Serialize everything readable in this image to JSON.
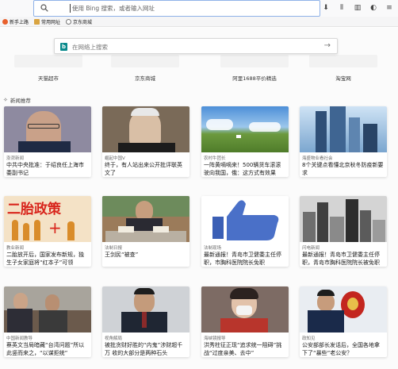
{
  "urlbar": {
    "placeholder": "使用 Bing 搜索，或者输入网址"
  },
  "toolbar_icons": [
    "download-icon",
    "library-icon",
    "sidebar-icon",
    "reader-icon",
    "menu-icon"
  ],
  "bookmarks": [
    {
      "label": "新手上路",
      "icon": "firefox-icon",
      "color": "#e8602c"
    },
    {
      "label": "常用网址",
      "icon": "folder-icon",
      "color": "#d9a441"
    },
    {
      "label": "京东商城",
      "icon": "globe-icon",
      "color": "#777777"
    }
  ],
  "bing": {
    "placeholder": "在网络上搜索",
    "logo": "b"
  },
  "shortcuts": [
    {
      "label": "天猫超市"
    },
    {
      "label": "京东商城"
    },
    {
      "label": "阿里1688平价精选"
    },
    {
      "label": "淘宝网"
    }
  ],
  "section": {
    "title": "新闻推荐"
  },
  "cards": [
    {
      "source": "澎湃新闻",
      "title": "中共中央批准：于绍良任上海市委副书记",
      "img": "portrait-glasses"
    },
    {
      "source": "崛起中国V",
      "title": "终于，有人站出来公开批评联英文了",
      "img": "portrait-elder"
    },
    {
      "source": "农村牛团长",
      "title": "一阵黄嘀嘀来！500辆货车滚滚驶向我国，俄：这方式有效果",
      "img": "grassland"
    },
    {
      "source": "海盛物业看社会",
      "title": "8个关键点看懂北京秋冬防疫新要求",
      "img": "skyscrapers"
    },
    {
      "source": "教业新闻",
      "title": "二胎放开后，国家发布新规，独生子女家庭将“红本子”可领",
      "img": "two-child-poster"
    },
    {
      "source": "法制日报",
      "title": "王剑民“被查”",
      "img": "meeting"
    },
    {
      "source": "法制现场",
      "title": "最新通报！青岛市卫健委主任停职，市胸科医院院长免职",
      "img": "thumbs-up"
    },
    {
      "source": "闪电新闻",
      "title": "最新通报！青岛市卫健委主任停职，青岛市胸科医院院长被免职",
      "img": "city-bw"
    },
    {
      "source": "中国新闻教导",
      "title": "蔡英文当局暗藏“台湾问题”所以此竖而来之，“以谋拒统”",
      "img": "two-men"
    },
    {
      "source": "视角解局",
      "title": "被批贪财好胜的“内鬼”涉财超千万 收的大部分是两种石头",
      "img": "official"
    },
    {
      "source": "海峡镜报导",
      "title": "洪秀柱征正现“追求统一阻碍”挑战“过度亲美、去中”",
      "img": "woman-mask"
    },
    {
      "source": "政知见",
      "title": "公安部部长发话后，全国各地拿下了“暴些”老公安？",
      "img": "police"
    }
  ]
}
